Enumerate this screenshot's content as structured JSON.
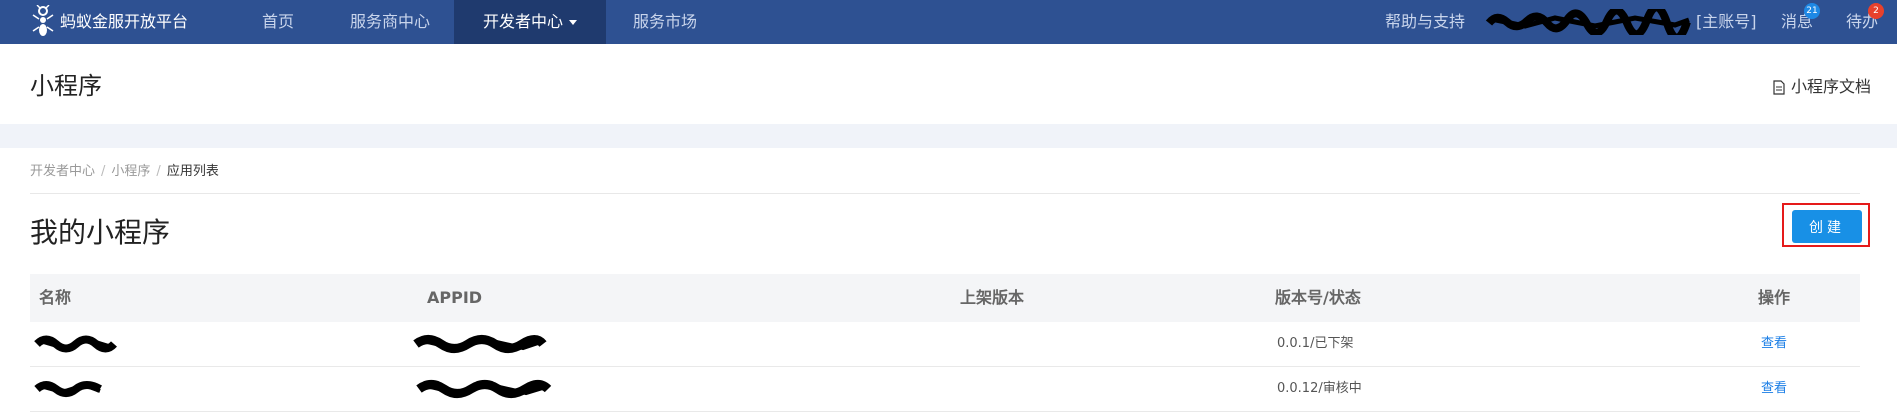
{
  "topbar": {
    "brand": "蚂蚁金服开放平台",
    "logo_icon": "ant-logo-icon",
    "nav": [
      {
        "label": "首页",
        "active": false
      },
      {
        "label": "服务商中心",
        "active": false
      },
      {
        "label": "开发者中心",
        "active": true
      },
      {
        "label": "服务市场",
        "active": false
      }
    ],
    "help": "帮助与支持",
    "account_type": "[主账号]",
    "messages": {
      "label": "消息",
      "badge": "21"
    },
    "todo": {
      "label": "待办",
      "badge": "2"
    }
  },
  "header": {
    "title": "小程序",
    "doc_link": "小程序文档",
    "doc_icon": "document-icon"
  },
  "breadcrumb": [
    "开发者中心",
    "小程序",
    "应用列表"
  ],
  "section": {
    "title": "我的小程序",
    "create_button": "创建"
  },
  "table": {
    "columns": [
      "名称",
      "APPID",
      "上架版本",
      "版本号/状态",
      "操作"
    ],
    "rows": [
      {
        "version_status": "0.0.1/已下架",
        "action": "查看"
      },
      {
        "version_status": "0.0.12/审核中",
        "action": "查看"
      }
    ]
  },
  "colors": {
    "topbar": "#2e5192",
    "nav_active": "#1f3a6e",
    "primary": "#1890e6",
    "highlight_border": "#e51a1a",
    "link": "#1a7ee6"
  }
}
